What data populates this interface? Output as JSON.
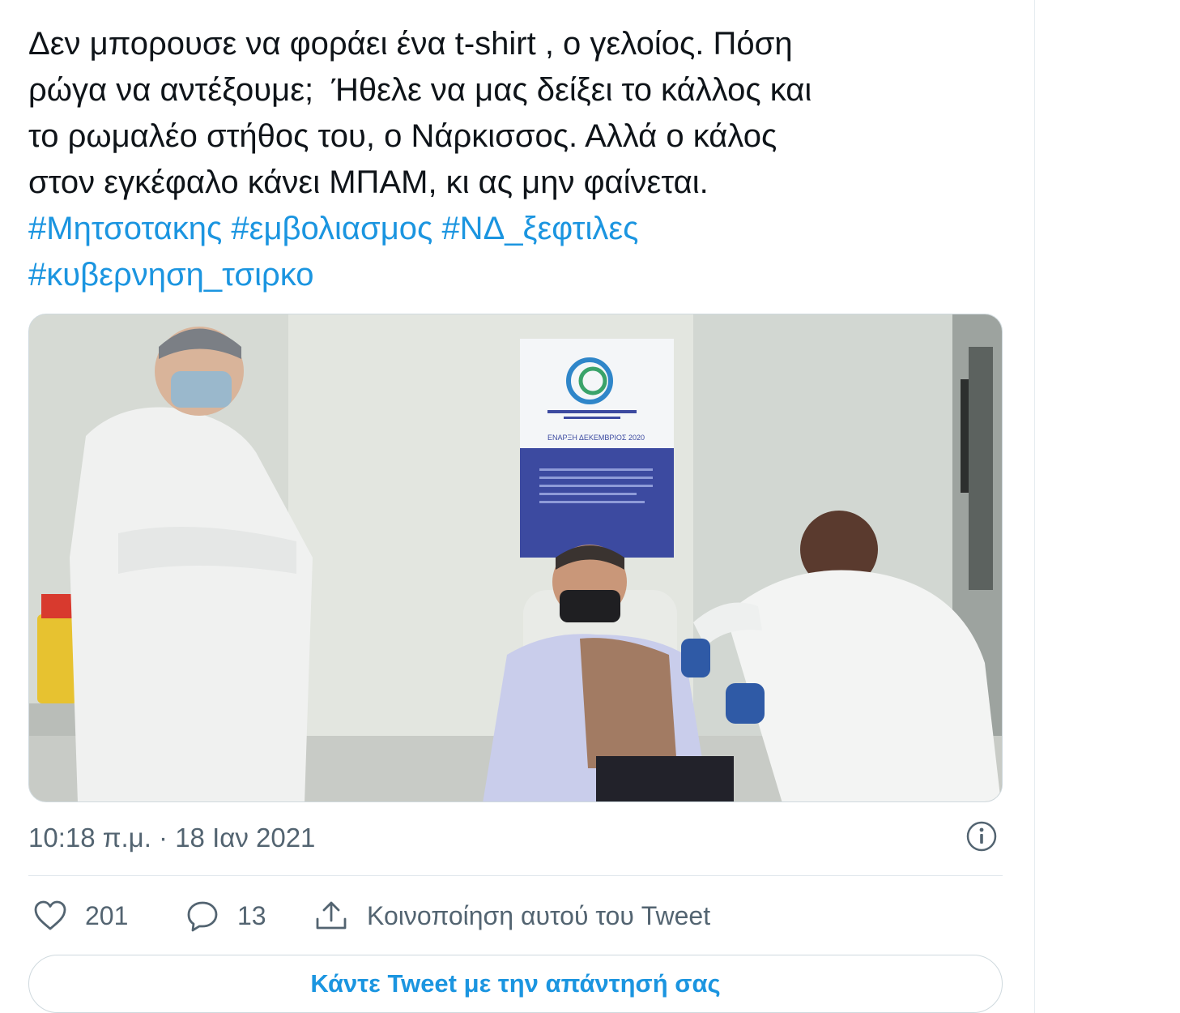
{
  "tweet": {
    "text_lines": [
      "Δεν μπορουσε να φοράει ένα t-shirt , ο γελοίος. Πόση",
      "ρώγα να αντέξουμε;  Ήθελε να μας δείξει το κάλλος και",
      "το ρωμαλέο στήθος του, ο Νάρκισσος. Αλλά ο κάλος",
      "στον εγκέφαλο κάνει ΜΠΑΜ, κι ας μην φαίνεται."
    ],
    "hashtags": [
      "#Μητσοτακης",
      "#εμβολιασμος",
      "#ΝΔ_ξεφτιλες",
      "#κυβερνηση_τσιρκο"
    ],
    "timestamp": "10:18 π.μ. · 18 Ιαν 2021"
  },
  "media": {
    "poster_caption": "ΕΝΑΡΞΗ ΔΕΚΕΜΒΡΙΟΣ 2020"
  },
  "actions": {
    "like_count": "201",
    "reply_count": "13",
    "share_label": "Κοινοποίηση αυτού του Tweet"
  },
  "reply_bar": {
    "label": "Κάντε Tweet με την απάντησή σας"
  },
  "icons": {
    "info": "info-icon",
    "like": "heart-icon",
    "reply": "comment-icon",
    "share": "share-icon"
  },
  "colors": {
    "text": "#0f1419",
    "secondary": "#536471",
    "link": "#1b95e0",
    "border": "#cfd9de"
  }
}
